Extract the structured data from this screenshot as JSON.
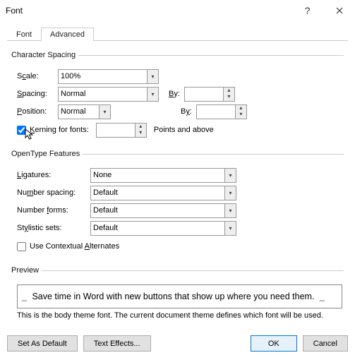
{
  "window": {
    "title": "Font"
  },
  "tabs": {
    "font": "Font",
    "advanced": "Advanced",
    "active": "advanced"
  },
  "charSpacing": {
    "legend": "Character Spacing",
    "scaleLabel": "Scale:",
    "scaleValue": "100%",
    "spacingLabel": "Spacing:",
    "spacingValue": "Normal",
    "spacingByLabel": "By:",
    "spacingByValue": "",
    "positionLabel": "Position:",
    "positionValue": "Normal",
    "positionByLabel": "By:",
    "positionByValue": "",
    "kerningChecked": true,
    "kerningLabel": "Kerning for fonts:",
    "kerningValue": "",
    "kerningSuffix": "Points and above"
  },
  "opentype": {
    "legend": "OpenType Features",
    "ligaturesLabel": "Ligatures:",
    "ligaturesValue": "None",
    "numSpacingLabel": "Number spacing:",
    "numSpacingValue": "Default",
    "numFormsLabel": "Number forms:",
    "numFormsValue": "Default",
    "styleSetsLabel": "Stylistic sets:",
    "styleSetsValue": "Default",
    "contextualChecked": false,
    "contextualLabel": "Use Contextual Alternates"
  },
  "preview": {
    "legend": "Preview",
    "text": "Save time in Word with new buttons that show up where you need them.",
    "note": "This is the body theme font. The current document theme defines which font will be used."
  },
  "footer": {
    "setDefault": "Set As Default",
    "textEffects": "Text Effects...",
    "ok": "OK",
    "cancel": "Cancel"
  }
}
